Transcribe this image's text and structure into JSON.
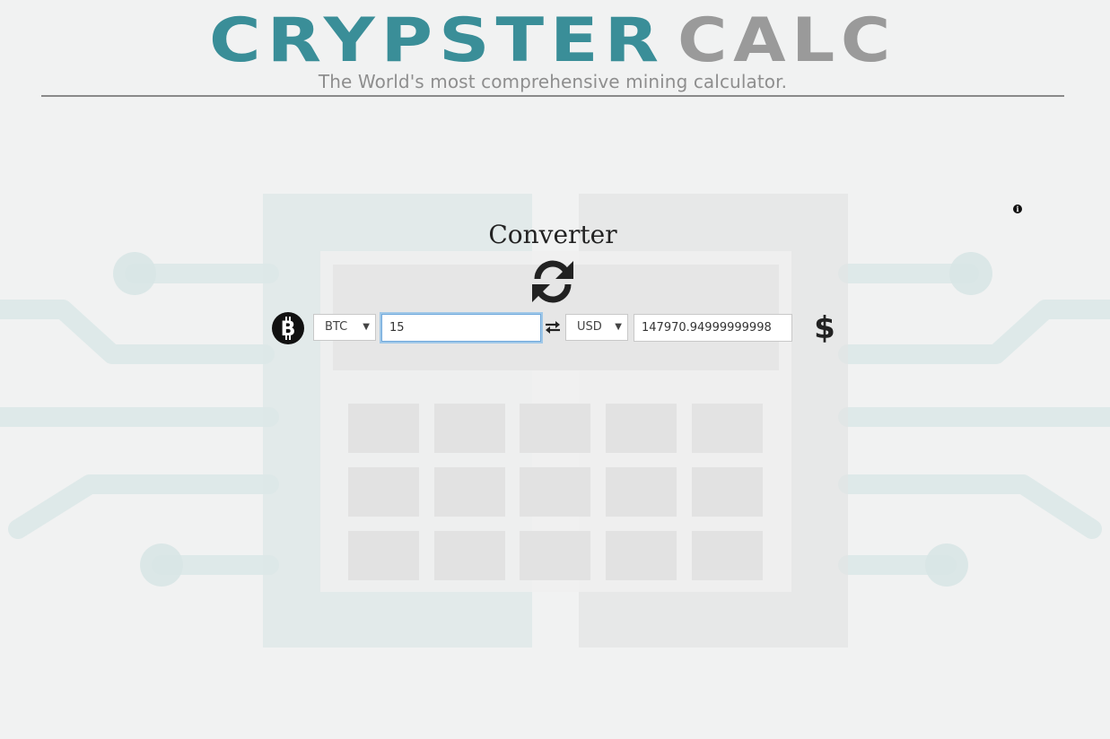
{
  "header": {
    "logo_primary": "CRYPSTER",
    "logo_secondary": "CALC",
    "tagline": "The World's most comprehensive mining calculator."
  },
  "converter": {
    "title": "Converter",
    "from_currency": "BTC",
    "amount": "15",
    "to_currency": "USD",
    "result": "147970.94999999998"
  },
  "icons": {
    "info": "info-icon",
    "refresh": "refresh-icon",
    "bitcoin": "bitcoin-icon",
    "swap": "swap-arrows-icon",
    "dollar": "dollar-icon"
  },
  "colors": {
    "logo_primary": "#3a8e98",
    "logo_secondary": "#9a9a9a",
    "tagline": "#8e8e8e",
    "background": "#f1f2f2"
  }
}
